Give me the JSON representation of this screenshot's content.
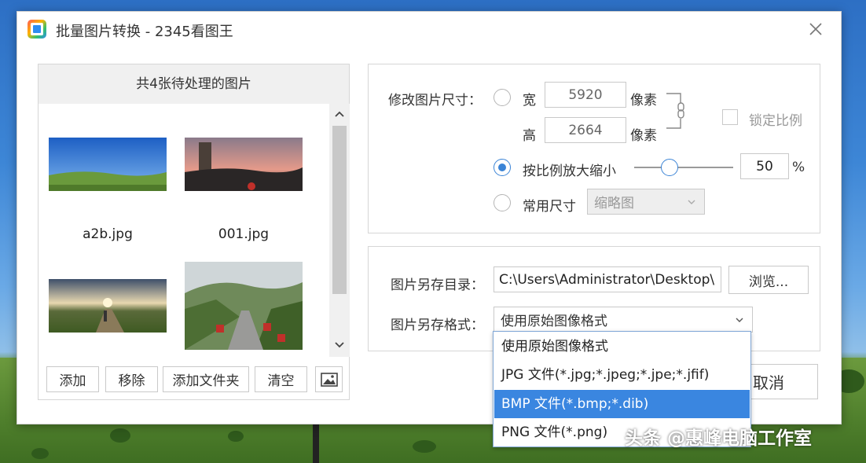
{
  "window": {
    "title": "批量图片转换 - 2345看图王"
  },
  "left": {
    "header": "共4张待处理的图片",
    "thumbnails": [
      {
        "name": "a2b.jpg"
      },
      {
        "name": "001.jpg"
      },
      {
        "name": ""
      },
      {
        "name": ""
      }
    ],
    "buttons": {
      "add": "添加",
      "remove": "移除",
      "add_folder": "添加文件夹",
      "clear": "清空"
    }
  },
  "resize": {
    "label": "修改图片尺寸：",
    "width_label": "宽",
    "width_value": "5920",
    "height_label": "高",
    "height_value": "2664",
    "unit": "像素",
    "lock_ratio": "锁定比例",
    "scale_label": "按比例放大缩小",
    "scale_value": "50",
    "scale_fraction": 0.36,
    "percent": "%",
    "common_label": "常用尺寸",
    "common_value": "缩略图"
  },
  "save": {
    "dir_label": "图片另存目录：",
    "dir_value": "C:\\Users\\Administrator\\Desktop\\",
    "browse": "浏览...",
    "format_label": "图片另存格式：",
    "format_value": "使用原始图像格式",
    "options": [
      "使用原始图像格式",
      "JPG 文件(*.jpg;*.jpeg;*.jpe;*.jfif)",
      "BMP 文件(*.bmp;*.dib)",
      "PNG 文件(*.png)"
    ]
  },
  "footer": {
    "cancel": "取消"
  },
  "watermark": "头条 @惠峰电脑工作室",
  "colors": {
    "accent": "#3b84d6",
    "selected": "#3a86e0"
  }
}
